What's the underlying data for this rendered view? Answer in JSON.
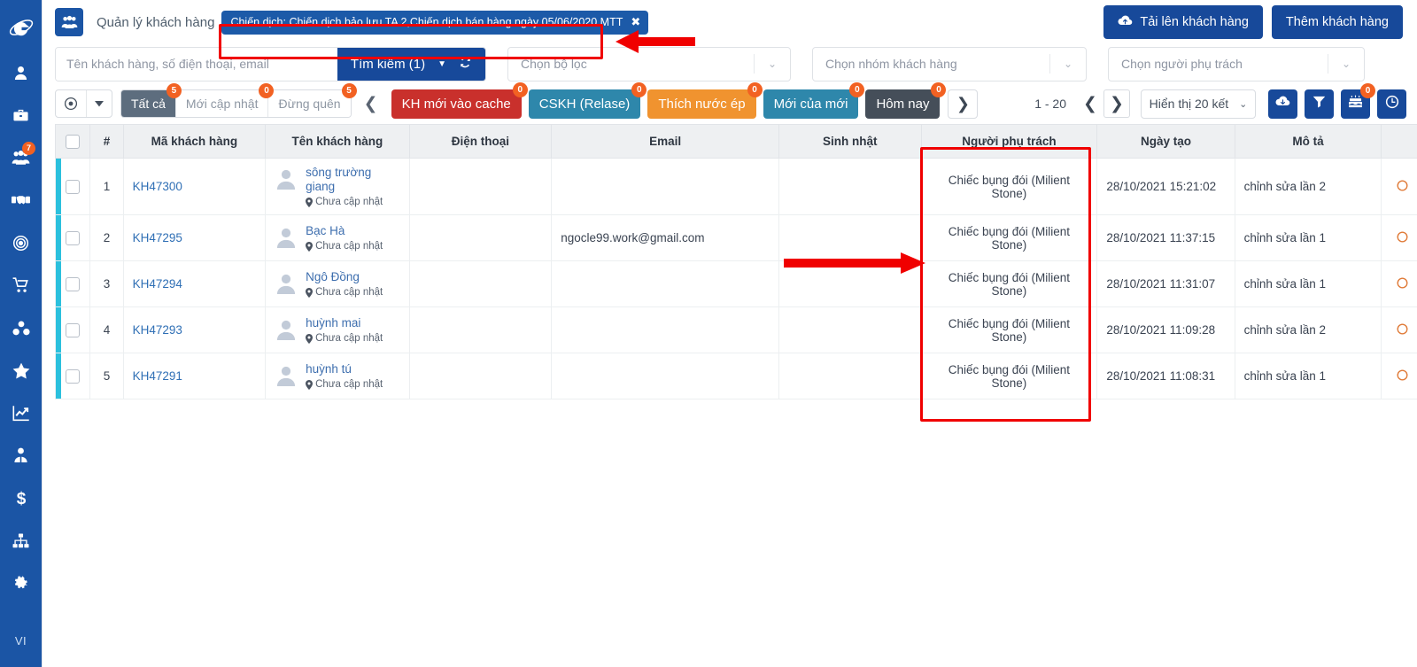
{
  "sidebar": {
    "logo": "g-logo-icon",
    "items": [
      {
        "name": "user-icon",
        "badge": null
      },
      {
        "name": "briefcase-icon",
        "badge": null
      },
      {
        "name": "users-group-icon",
        "badge": "7"
      },
      {
        "name": "handshake-icon",
        "badge": null
      },
      {
        "name": "target-icon",
        "badge": null
      },
      {
        "name": "cart-icon",
        "badge": null
      },
      {
        "name": "boxes-icon",
        "badge": null
      },
      {
        "name": "star-icon",
        "badge": null
      },
      {
        "name": "chart-line-icon",
        "badge": null
      },
      {
        "name": "employee-icon",
        "badge": null
      },
      {
        "name": "dollar-icon",
        "badge": null
      },
      {
        "name": "sitemap-icon",
        "badge": null
      },
      {
        "name": "gear-icon",
        "badge": null
      }
    ],
    "language": "VI"
  },
  "header": {
    "icon": "customers-icon",
    "title": "Quản lý khách hàng",
    "campaign_tag": {
      "text": "Chiến dịch: Chiến dịch bảo lưu TA 2,Chiến dịch bán hàng ngày 05/06/2020 MTT",
      "close": "✖"
    },
    "upload_button": "Tải lên khách hàng",
    "add_button": "Thêm khách hàng"
  },
  "filters": {
    "search_placeholder": "Tên khách hàng, số điện thoại, email",
    "search_value": "",
    "search_button": "Tìm kiếm (1)",
    "filter_select": "Chọn bộ lọc",
    "group_select": "Chọn nhóm khách hàng",
    "owner_select": "Chọn người phụ trách"
  },
  "tabs": {
    "segments": [
      {
        "label": "Tất cả",
        "badge": "5",
        "active": true
      },
      {
        "label": "Mới cập nhật",
        "badge": "0",
        "active": false
      },
      {
        "label": "Đừng quên",
        "badge": "5",
        "active": false
      }
    ],
    "chips": [
      {
        "label": "KH mới vào cache",
        "badge": "0",
        "color": "#c9302c"
      },
      {
        "label": "CSKH (Relase)",
        "badge": "0",
        "color": "#2e87ab"
      },
      {
        "label": "Thích nước ép",
        "badge": "0",
        "color": "#f0932f"
      },
      {
        "label": "Mới của mới",
        "badge": "0",
        "color": "#2e87ab"
      },
      {
        "label": "Hôm nay",
        "badge": "0",
        "color": "#454e59"
      }
    ]
  },
  "pagination": {
    "range": "1 - 20",
    "per_page": "Hiển thị 20 kết",
    "tools": [
      {
        "name": "cloud-download-icon",
        "badge": null
      },
      {
        "name": "filter-icon",
        "badge": null
      },
      {
        "name": "birthday-cake-icon",
        "badge": "0"
      },
      {
        "name": "clock-icon",
        "badge": null
      }
    ]
  },
  "table": {
    "columns": [
      "#",
      "Mã khách hàng",
      "Tên khách hàng",
      "Điện thoại",
      "Email",
      "Sinh nhật",
      "Người phụ trách",
      "Ngày tạo",
      "Mô tả"
    ],
    "rows": [
      {
        "index": "1",
        "code": "KH47300",
        "name": "sông trường giang",
        "address": "Chưa cập nhật",
        "phone": "",
        "email": "",
        "birthday": "",
        "owner": "Chiếc bụng đói (Milient Stone)",
        "created": "28/10/2021 15:21:02",
        "description": "chỉnh sửa lần 2"
      },
      {
        "index": "2",
        "code": "KH47295",
        "name": "Bạc Hà",
        "address": "Chưa cập nhật",
        "phone": "",
        "email": "ngocle99.work@gmail.com",
        "birthday": "",
        "owner": "Chiếc bụng đói (Milient Stone)",
        "created": "28/10/2021 11:37:15",
        "description": "chỉnh sửa lần 1"
      },
      {
        "index": "3",
        "code": "KH47294",
        "name": "Ngô Đồng",
        "address": "Chưa cập nhật",
        "phone": "",
        "email": "",
        "birthday": "",
        "owner": "Chiếc bụng đói (Milient Stone)",
        "created": "28/10/2021 11:31:07",
        "description": "chỉnh sửa lần 1"
      },
      {
        "index": "4",
        "code": "KH47293",
        "name": "huỳnh mai",
        "address": "Chưa cập nhật",
        "phone": "",
        "email": "",
        "birthday": "",
        "owner": "Chiếc bụng đói (Milient Stone)",
        "created": "28/10/2021 11:09:28",
        "description": "chỉnh sửa lần 2"
      },
      {
        "index": "5",
        "code": "KH47291",
        "name": "huỳnh tú",
        "address": "Chưa cập nhật",
        "phone": "",
        "email": "",
        "birthday": "",
        "owner": "Chiếc bụng đói (Milient Stone)",
        "created": "28/10/2021 11:08:31",
        "description": "chỉnh sửa lần 1"
      }
    ]
  },
  "annotations": {
    "color": "#f00000",
    "rect_campaign": "highlights campaign filter tag",
    "rect_owner": "highlights Người phụ trách column",
    "arrow_top": "points at campaign tag",
    "arrow_mid": "points at owner column"
  },
  "colors": {
    "sidebar": "#1b55a5",
    "primary": "#17499a",
    "accent_badge": "#f26122",
    "row_stripe": "#2bc0dd",
    "annotation": "#f00000"
  }
}
